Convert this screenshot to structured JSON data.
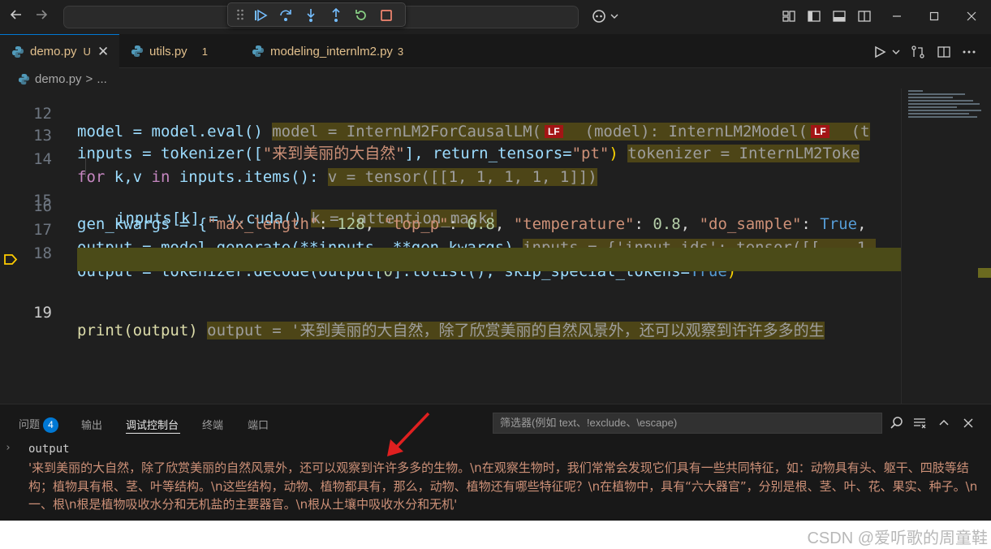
{
  "colors": {
    "accent": "#0078d4",
    "annotation_arrow": "#e02020",
    "string": "#ce9178",
    "lf_badge": "#a31515"
  },
  "tabs": [
    {
      "label": "demo.py",
      "status": "U",
      "active": true
    },
    {
      "label": "utils.py",
      "status": "1",
      "active": false
    },
    {
      "label": "modeling_internlm2.py",
      "status": "3",
      "active": false
    }
  ],
  "breadcrumb": {
    "file": "demo.py",
    "separator": ">",
    "more": "..."
  },
  "editor": {
    "line_numbers": [
      "12",
      "13",
      "14",
      "15",
      "16",
      "17",
      "18",
      "19"
    ],
    "current_line": "19",
    "lines": {
      "l12": {
        "code": "model = model.eval()",
        "inline": "model = InternLM2ForCausalLM(",
        "inline_b": "(model): InternLM2Model(",
        "inline_c": "(t",
        "lf": "LF"
      },
      "l13": {
        "code_a": "inputs = tokenizer([",
        "str": "\"来到美丽的大自然\"",
        "code_b": "], return_tensors=",
        "str2": "\"pt\"",
        "code_c": ")",
        "inline": "tokenizer = InternLM2Toke"
      },
      "l14": {
        "kw_for": "for",
        "code_a": " k,v ",
        "kw_in": "in",
        "code_b": " inputs.items():",
        "inline": "v = tensor([[1, 1, 1, 1, 1]])"
      },
      "l15": {
        "code": "inputs[k] = v.cuda()",
        "inline": "k = 'attention_mask'"
      },
      "l16": {
        "code_a": "gen_kwargs = {",
        "s1": "\"max_length\"",
        "c1": ": ",
        "n1": "128",
        "c2": ", ",
        "s2": "\"top_p\"",
        "c3": ": ",
        "n2": "0.8",
        "c4": ", ",
        "s3": "\"temperature\"",
        "c5": ": ",
        "n3": "0.8",
        "c6": ", ",
        "s4": "\"do_sample\"",
        "c7": ": ",
        "b1": "True",
        "c8": ","
      },
      "l17": {
        "code": "output = model.generate(**inputs, **gen_kwargs)",
        "inline": "inputs = {'input_ids': tensor([[    1,"
      },
      "l18": {
        "code_a": "output = tokenizer.decode(output[",
        "n": "0",
        "code_b": "].tolist(), skip_special_tokens=",
        "b": "True",
        "code_c": ")"
      },
      "l19": {
        "code": "print(output)",
        "inline": "output = '来到美丽的大自然，除了欣赏美丽的自然风景外，还可以观察到许许多多的生"
      }
    }
  },
  "panel": {
    "tabs": [
      {
        "label": "问题",
        "badge": "4"
      },
      {
        "label": "输出"
      },
      {
        "label": "调试控制台",
        "active": true
      },
      {
        "label": "终端"
      },
      {
        "label": "端口"
      }
    ],
    "filter_placeholder": "筛选器(例如 text、!exclude、\\escape)",
    "console": {
      "expression": "output",
      "result": "'来到美丽的大自然，除了欣赏美丽的自然风景外，还可以观察到许许多多的生物。\\n在观察生物时，我们常常会发现它们具有一些共同特征，如：动物具有头、躯干、四肢等结构；植物具有根、茎、叶等结构。\\n这些结构，动物、植物都具有，那么，动物、植物还有哪些特征呢？\\n在植物中，具有“六大器官”，分别是根、茎、叶、花、果实、种子。\\n一、根\\n根是植物吸收水分和无机盐的主要器官。\\n根从土壤中吸收水分和无机'"
    }
  },
  "watermark": "CSDN @爱听歌的周童鞋"
}
